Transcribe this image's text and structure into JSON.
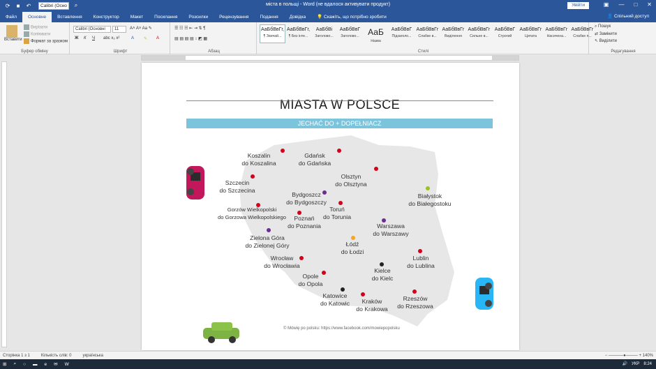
{
  "window": {
    "title": "міста в польщі - Word (не вдалося активувати продукт)",
    "font_box": "Calibri (Осно",
    "sign_in": "Увійти",
    "share": "Спільний доступ"
  },
  "tabs": [
    "Файл",
    "Основне",
    "Вставлення",
    "Конструктор",
    "Макет",
    "Посилання",
    "Розсилки",
    "Рецензування",
    "Подання",
    "Довідка"
  ],
  "tell_me": "Скажіть, що потрібно зробити",
  "ribbon": {
    "clipboard": {
      "paste": "Вставити",
      "cut": "Вирізати",
      "copy": "Копіювати",
      "format_painter": "Формат за зразком",
      "label": "Буфер обміну"
    },
    "font": {
      "name": "Calibri (Основні",
      "size": "11",
      "label": "Шрифт"
    },
    "paragraph_label": "Абзац",
    "styles_label": "Стилі",
    "styles": [
      {
        "sample": "АаБбВвГг,",
        "name": "¶ Звичай..."
      },
      {
        "sample": "АаБбВвГг,",
        "name": "¶ Без інте..."
      },
      {
        "sample": "АаБбВі",
        "name": "Заголово..."
      },
      {
        "sample": "АаБбВвГ",
        "name": "Заголово..."
      },
      {
        "sample": "АаБ",
        "name": "Назва"
      },
      {
        "sample": "АаБбВвГ",
        "name": "Підзаголо..."
      },
      {
        "sample": "АаБбВвГг",
        "name": "Слабке в..."
      },
      {
        "sample": "АаБбВвГг",
        "name": "Виділення"
      },
      {
        "sample": "АаБбВвГг",
        "name": "Сильне в..."
      },
      {
        "sample": "АаБбВвГ",
        "name": "Строгий"
      },
      {
        "sample": "АаБбВвГг",
        "name": "Цитата"
      },
      {
        "sample": "АаБбВвГг",
        "name": "Насичена..."
      },
      {
        "sample": "АаБбВвГг",
        "name": "Слабке п..."
      }
    ],
    "editing": {
      "find": "Пошук",
      "replace": "Замінити",
      "select": "Виділити",
      "label": "Редагування"
    }
  },
  "document": {
    "title": "MIASTA W POLSCE",
    "banner": "JECHAĆ DO + DOPEŁNIACZ",
    "credit": "© Mówię po polsku: https://www.facebook.com/mowiepopolsku",
    "cities": [
      {
        "name": "Koszalin",
        "phrase": "do Koszalina",
        "color": "#d0021b"
      },
      {
        "name": "Gdańsk",
        "phrase": "do Gdańska",
        "color": "#d0021b"
      },
      {
        "name": "Olsztyn",
        "phrase": "do Olsztyna",
        "color": "#d0021b"
      },
      {
        "name": "Szczecin",
        "phrase": "do Szczecina",
        "color": "#d0021b"
      },
      {
        "name": "Bydgoszcz",
        "phrase": "do Bydgoszczy",
        "color": "#6a2c91"
      },
      {
        "name": "Białystok",
        "phrase": "do Białegostoku",
        "color": "#9ac31c"
      },
      {
        "name": "Gorzów Wielkopolski",
        "phrase": "do Gorzowa Wielkopolskiego",
        "color": "#d0021b"
      },
      {
        "name": "Toruń",
        "phrase": "do Torunia",
        "color": "#d0021b"
      },
      {
        "name": "Poznań",
        "phrase": "do Poznania",
        "color": "#d0021b"
      },
      {
        "name": "Warszawa",
        "phrase": "do Warszawy",
        "color": "#6a2c91"
      },
      {
        "name": "Zielona Góra",
        "phrase": "do Zielonej Góry",
        "color": "#6a2c91"
      },
      {
        "name": "Łódź",
        "phrase": "do Łodzi",
        "color": "#f5a623"
      },
      {
        "name": "Lublin",
        "phrase": "do Lublina",
        "color": "#d0021b"
      },
      {
        "name": "Wrocław",
        "phrase": "do Wrocławia",
        "color": "#d0021b"
      },
      {
        "name": "Opole",
        "phrase": "do Opola",
        "color": "#d0021b"
      },
      {
        "name": "Kielce",
        "phrase": "do Kielc",
        "color": "#222222"
      },
      {
        "name": "Katowice",
        "phrase": "do Katowic",
        "color": "#222222"
      },
      {
        "name": "Kraków",
        "phrase": "do Krakowa",
        "color": "#d0021b"
      },
      {
        "name": "Rzeszów",
        "phrase": "do Rzeszowa",
        "color": "#d0021b"
      }
    ]
  },
  "status": {
    "page": "Сторінка 1 з 1",
    "words": "Кількість слів: 0",
    "lang": "українська",
    "zoom": "140%"
  },
  "taskbar": {
    "lang": "УКР",
    "time": "8:24"
  }
}
